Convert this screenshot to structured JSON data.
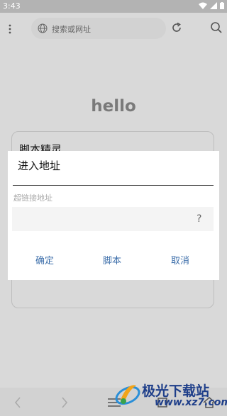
{
  "status_bar": {
    "time": "3:43"
  },
  "toolbar": {
    "address_placeholder": "搜索或网址"
  },
  "page": {
    "hello_text": "hello",
    "card_title": "脚本精灵"
  },
  "dialog": {
    "title": "进入地址",
    "field_label": "超链接地址",
    "input_value": "",
    "help_label": "?",
    "confirm_label": "确定",
    "script_label": "脚本",
    "cancel_label": "取消"
  },
  "watermark": {
    "title": "极光下载站",
    "url": "www.xz7.com"
  },
  "colors": {
    "accent": "#3c6eaa",
    "overlay_bg": "#d9d9d9",
    "dialog_bg": "#ffffff",
    "watermark": "#1f3f8a"
  }
}
